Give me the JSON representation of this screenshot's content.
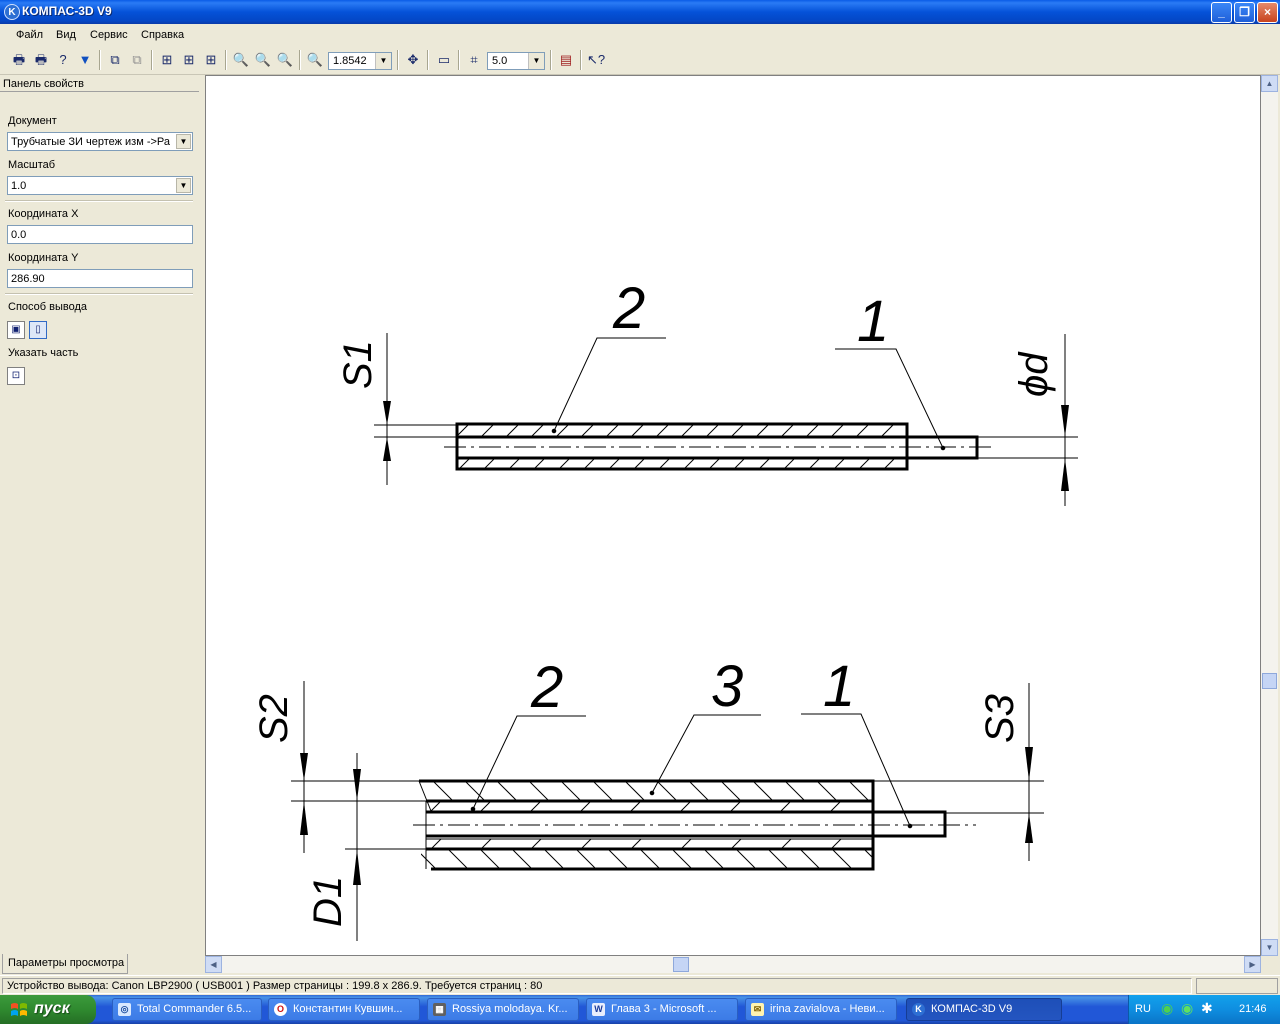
{
  "window": {
    "title": "КОМПАС-3D V9",
    "app_icon": "kompas-logo-icon",
    "controls": {
      "minimize": "_",
      "restore": "❐",
      "close": "×"
    }
  },
  "menu": [
    "Файл",
    "Вид",
    "Сервис",
    "Справка"
  ],
  "toolbar": {
    "zoom_value": "1.8542",
    "step_value": "5.0"
  },
  "panel": {
    "title": "Панель свойств",
    "document_label": "Документ",
    "document_value": "Трубчатые ЗИ чертеж изм ->Ра",
    "scale_label": "Масштаб",
    "scale_value": "1.0",
    "coord_x_label": "Координата X",
    "coord_x_value": "0.0",
    "coord_y_label": "Координата Y",
    "coord_y_value": "286.90",
    "output_label": "Способ вывода",
    "part_label": "Указать часть",
    "tab_label": "Параметры просмотра"
  },
  "drawing": {
    "top": {
      "leader_2": "2",
      "leader_1": "1",
      "dim_s1": "S1",
      "dim_d": "ϕd"
    },
    "bottom": {
      "leader_2": "2",
      "leader_3": "3",
      "leader_1": "1",
      "dim_s2": "S2",
      "dim_s3": "S3",
      "dim_d1": "D1"
    }
  },
  "status": {
    "text": "Устройство вывода: Canon LBP2900 ( USB001 )  Размер страницы : 199.8 x 286.9.  Требуется страниц : 80"
  },
  "taskbar": {
    "start": "пуск",
    "tasks": [
      {
        "label": "Total Commander 6.5...",
        "icon": "total-commander-icon"
      },
      {
        "label": "Константин Кувшин...",
        "icon": "opera-icon"
      },
      {
        "label": "Rossiya molodaya. Kr...",
        "icon": "video-icon"
      },
      {
        "label": "Глава 3 - Microsoft ...",
        "icon": "word-icon"
      },
      {
        "label": "irina zavialova - Неви...",
        "icon": "mail-icon"
      },
      {
        "label": "КОМПАС-3D V9",
        "icon": "kompas-logo-icon"
      }
    ],
    "lang": "RU",
    "clock": "21:46"
  }
}
